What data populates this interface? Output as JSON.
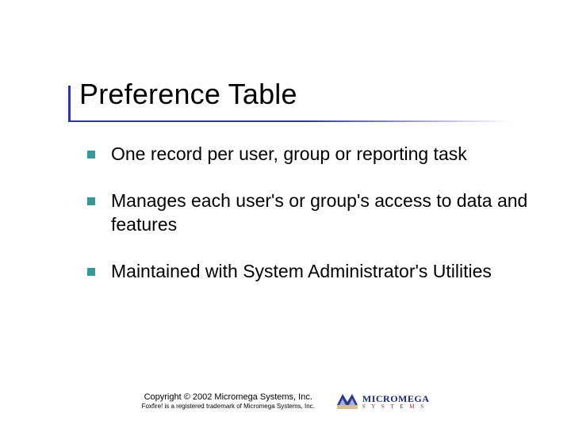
{
  "title": "Preference Table",
  "bullets": [
    "One record per user, group or reporting task",
    "Manages each user's or group's access to data and features",
    "Maintained with System Administrator's Utilities"
  ],
  "footer": {
    "copyright": "Copyright © 2002 Micromega Systems, Inc.",
    "trademark": "Foxfire! is a registered trademark of Micromega Systems, Inc."
  },
  "logo": {
    "name": "MICROMEGA",
    "sub": "S Y S T E M S"
  }
}
